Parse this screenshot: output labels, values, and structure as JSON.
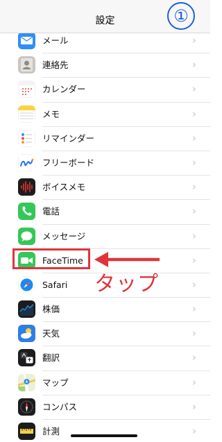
{
  "header": {
    "title": "設定",
    "step_badge": "①"
  },
  "annotation": {
    "label": "タップ",
    "color": "#e0343b"
  },
  "rows": [
    {
      "label": "メール",
      "icon": "mail-icon"
    },
    {
      "label": "連絡先",
      "icon": "contacts-icon"
    },
    {
      "label": "カレンダー",
      "icon": "calendar-icon"
    },
    {
      "label": "メモ",
      "icon": "notes-icon"
    },
    {
      "label": "リマインダー",
      "icon": "reminders-icon"
    },
    {
      "label": "フリーボード",
      "icon": "freeform-icon"
    },
    {
      "label": "ボイスメモ",
      "icon": "voice-memos-icon"
    },
    {
      "label": "電話",
      "icon": "phone-icon"
    },
    {
      "label": "メッセージ",
      "icon": "messages-icon"
    },
    {
      "label": "FaceTime",
      "icon": "facetime-icon"
    },
    {
      "label": "Safari",
      "icon": "safari-icon"
    },
    {
      "label": "株価",
      "icon": "stocks-icon"
    },
    {
      "label": "天気",
      "icon": "weather-icon"
    },
    {
      "label": "翻訳",
      "icon": "translate-icon"
    },
    {
      "label": "マップ",
      "icon": "maps-icon"
    },
    {
      "label": "コンパス",
      "icon": "compass-icon"
    },
    {
      "label": "計測",
      "icon": "measure-icon"
    }
  ],
  "chevron": "›"
}
